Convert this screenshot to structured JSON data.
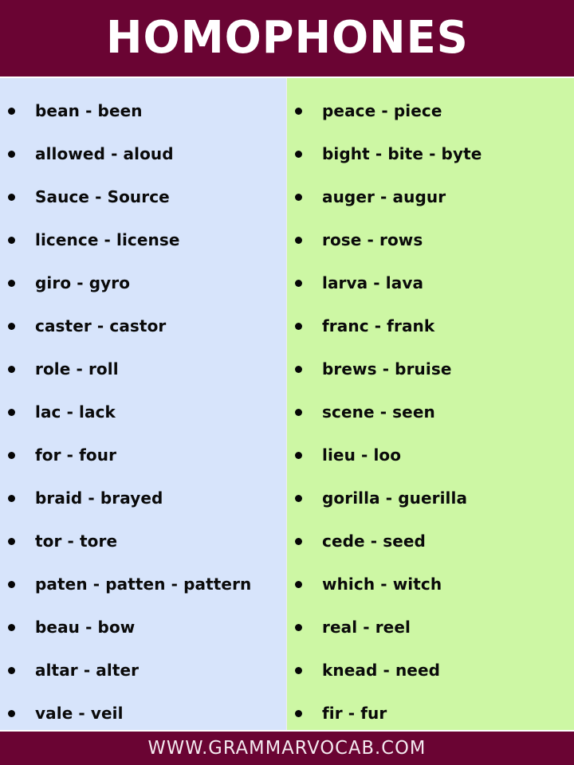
{
  "header": {
    "title": "HOMOPHONES",
    "background_color": "#6A0433",
    "text_color": "#FFFFFF"
  },
  "columns": [
    {
      "id": "left",
      "background_color": "#D7E4FB",
      "bullet_icon": "bullet-dot-icon",
      "items": [
        "bean - been",
        "allowed - aloud",
        "Sauce - Source",
        "licence - license",
        "giro - gyro",
        "caster - castor",
        "role - roll",
        "lac - lack",
        "for - four",
        "braid - brayed",
        "tor - tore",
        "paten - patten - pattern",
        "beau - bow",
        "altar - alter",
        "vale - veil"
      ]
    },
    {
      "id": "right",
      "background_color": "#CDF7A4",
      "bullet_icon": "bullet-dot-icon",
      "items": [
        "peace - piece",
        "bight - bite - byte",
        "auger - augur",
        "rose - rows",
        "larva - lava",
        "franc - frank",
        "brews - bruise",
        "scene - seen",
        "lieu - loo",
        "gorilla - guerilla",
        "cede - seed",
        "which - witch",
        "real - reel",
        "knead - need",
        "fir - fur"
      ]
    }
  ],
  "footer": {
    "text": "WWW.GRAMMARVOCAB.COM",
    "background_color": "#6A0433",
    "text_color": "#F4EAF0"
  }
}
